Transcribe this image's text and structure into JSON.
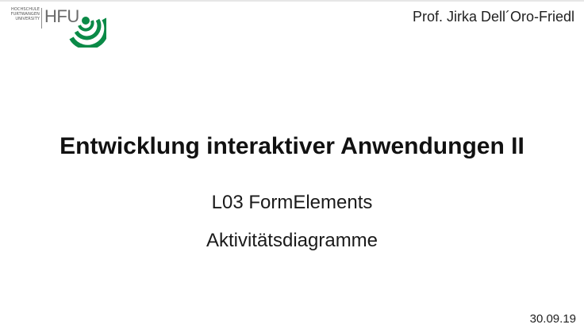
{
  "header": {
    "logo": {
      "institution_lines": [
        "HOCHSCHULE",
        "FURTWANGEN",
        "UNIVERSITY"
      ],
      "abbreviation": "HFU",
      "brand_color": "#0a8a47",
      "icon": "hfu-arcs-icon"
    },
    "author": "Prof. Jirka Dell´Oro-Friedl"
  },
  "main": {
    "title": "Entwicklung interaktiver Anwendungen II",
    "subtitle_1": "L03 FormElements",
    "subtitle_2": "Aktivitätsdiagramme"
  },
  "footer": {
    "date": "30.09.19"
  }
}
